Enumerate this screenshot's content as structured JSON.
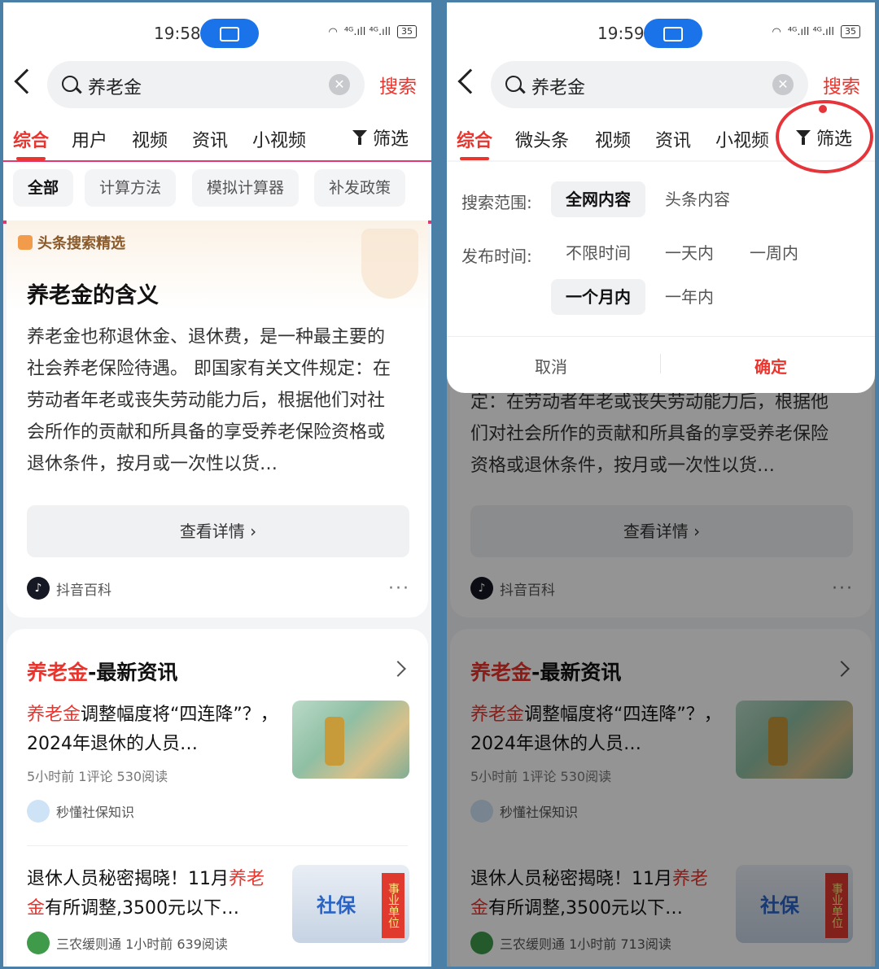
{
  "status": {
    "left_time": "19:58",
    "right_time": "19:59",
    "signal": "⁴ᴳ.ıll ⁴ᴳ.ıll",
    "battery": "35"
  },
  "search": {
    "query": "养老金",
    "button": "搜索"
  },
  "left": {
    "tabs": [
      "综合",
      "用户",
      "视频",
      "资讯",
      "小视频"
    ],
    "filter_label": "筛选",
    "chips": [
      "全部",
      "计算方法",
      "模拟计算器",
      "补发政策"
    ]
  },
  "right": {
    "tabs": [
      "综合",
      "微头条",
      "视频",
      "资讯",
      "小视频"
    ],
    "filter_label": "筛选",
    "filter_panel": {
      "scope_label": "搜索范围:",
      "scope_options": [
        "全网内容",
        "头条内容"
      ],
      "time_label": "发布时间:",
      "time_options": [
        "不限时间",
        "一天内",
        "一周内",
        "一个月内",
        "一年内"
      ],
      "cancel": "取消",
      "confirm": "确定"
    }
  },
  "card1": {
    "badge": "头条搜索精选",
    "title": "养老金的含义",
    "text": "养老金也称退休金、退休费，是一种最主要的社会养老保险待遇。 即国家有关文件规定：在劳动者年老或丧失劳动能力后，根据他们对社会所作的贡献和所具备的享受养老保险资格或退休条件，按月或一次性以货…",
    "text_right": "定：在劳动者年老或丧失劳动能力后，根据他们对社会所作的贡献和所具备的享受养老保险资格或退休条件，按月或一次性以货…",
    "detail_button": "查看详情 ›",
    "source": "抖音百科",
    "more": "···"
  },
  "card2": {
    "title_highlight": "养老金",
    "title_rest": "-最新资讯",
    "news": [
      {
        "title_hl": "养老金",
        "title_rest": "调整幅度将“四连降”？，2024年退休的人员…",
        "meta": "5小时前   1评论   530阅读",
        "source": "秒懂社保知识"
      },
      {
        "title_pre": "退休人员秘密揭晓！11月",
        "title_hl": "养老金",
        "title_rest": "有所调整,3500元以下…",
        "meta_left": "三农缓则通   1小时前   639阅读",
        "meta_right": "三农缓则通   1小时前   713阅读",
        "thumb_text": "社保",
        "thumb_tag": "事业单位"
      }
    ]
  },
  "colors": {
    "accent": "#e8352e",
    "blue": "#1a73e8"
  }
}
